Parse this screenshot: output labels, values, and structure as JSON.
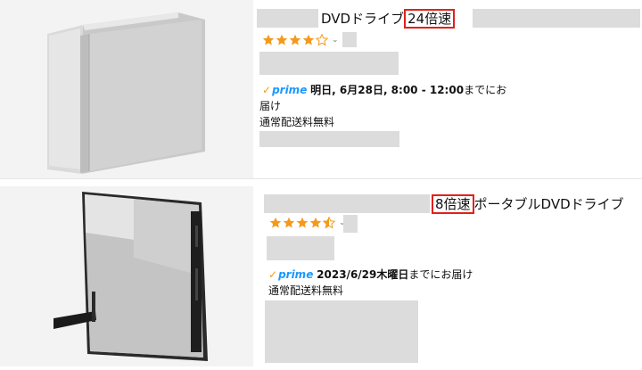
{
  "results": [
    {
      "title_main": "DVDドライブ",
      "title_highlight": "24倍速",
      "rating_stars": 4,
      "delivery_date": "明日, 6月28日, 8:00 - 12:00",
      "delivery_suffix": "までにお",
      "delivery_suffix2": "届け",
      "shipping": "通常配送料無料",
      "prime_label": "prime"
    },
    {
      "title_highlight": "8倍速",
      "title_main": "ポータブルDVDドライブ",
      "rating_stars": 4.5,
      "delivery_date": "2023/6/29木曜日",
      "delivery_suffix": "までにお届け",
      "shipping": "通常配送料無料",
      "prime_label": "prime"
    }
  ],
  "colors": {
    "highlight_border": "#e3201b",
    "star": "#f49a1a",
    "prime": "#1a98ff",
    "redaction": "#dcdcdc"
  },
  "icons": [
    "star-icon",
    "chevron-down-icon",
    "prime-check-icon"
  ]
}
